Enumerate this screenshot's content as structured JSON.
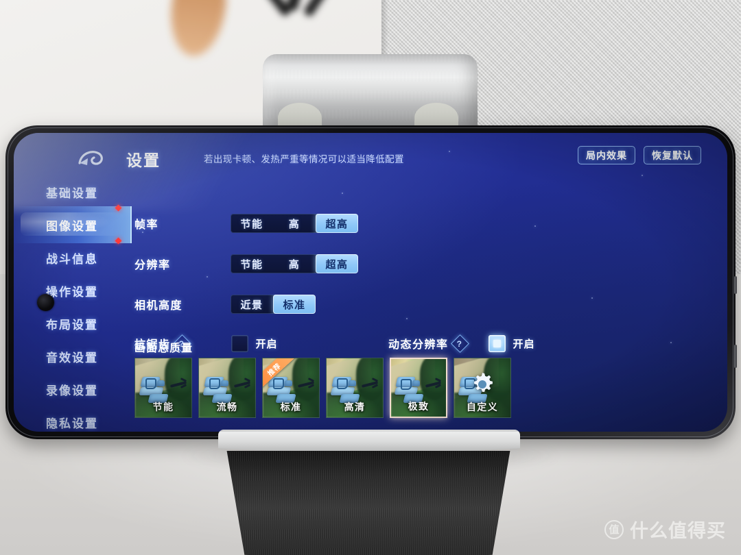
{
  "app": {
    "back_icon": "back-arrow-icon",
    "title": "设置",
    "hint": "若出现卡顿、发热严重等情况可以适当降低配置",
    "top_buttons": [
      {
        "label": "局内效果"
      },
      {
        "label": "恢复默认"
      }
    ]
  },
  "sidebar": {
    "items": [
      {
        "label": "基础设置",
        "active": false,
        "badge": true
      },
      {
        "label": "图像设置",
        "active": true,
        "badge": true
      },
      {
        "label": "战斗信息",
        "active": false,
        "badge": false
      },
      {
        "label": "操作设置",
        "active": false,
        "badge": false
      },
      {
        "label": "布局设置",
        "active": false,
        "badge": false
      },
      {
        "label": "音效设置",
        "active": false,
        "badge": false
      },
      {
        "label": "录像设置",
        "active": false,
        "badge": false
      },
      {
        "label": "隐私设置",
        "active": false,
        "badge": false
      }
    ]
  },
  "settings": {
    "frame_rate": {
      "label": "帧率",
      "options": [
        "节能",
        "高",
        "超高"
      ],
      "selected": "超高"
    },
    "resolution": {
      "label": "分辨率",
      "options": [
        "节能",
        "高",
        "超高"
      ],
      "selected": "超高"
    },
    "camera_height": {
      "label": "相机高度",
      "options": [
        "近景",
        "标准"
      ],
      "selected": "标准"
    },
    "anti_aliasing": {
      "label": "抗锯齿",
      "help_icon": "question-mark-icon",
      "checkbox_label": "开启",
      "checked": false
    },
    "dynamic_resolution": {
      "label": "动态分辨率",
      "help_icon": "question-mark-icon",
      "checkbox_label": "开启",
      "checked": true
    },
    "overall_quality": {
      "label": "画面总质量",
      "selected": "极致",
      "recommended": "标准",
      "recommended_ribbon": "推荐",
      "options": [
        {
          "label": "节能",
          "selected": false,
          "recommended": false,
          "icon": null
        },
        {
          "label": "流畅",
          "selected": false,
          "recommended": false,
          "icon": null
        },
        {
          "label": "标准",
          "selected": false,
          "recommended": true,
          "icon": null
        },
        {
          "label": "高清",
          "selected": false,
          "recommended": false,
          "icon": null
        },
        {
          "label": "极致",
          "selected": true,
          "recommended": false,
          "icon": null
        },
        {
          "label": "自定义",
          "selected": false,
          "recommended": false,
          "icon": "gear-icon"
        }
      ]
    }
  },
  "watermark": {
    "badge": "值",
    "text": "什么值得买"
  },
  "colors": {
    "screen_blue": "#24309a",
    "accent_light_blue": "#8fc8f8",
    "selected_border": "#f3ded0",
    "ribbon_orange": "#ff8a3d",
    "badge_red": "#ff3a3a"
  }
}
